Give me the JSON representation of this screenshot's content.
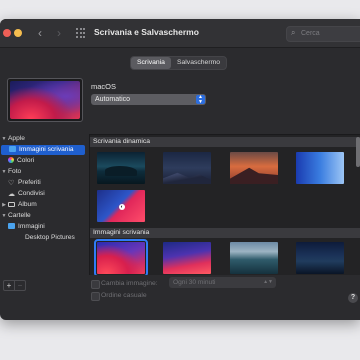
{
  "window": {
    "title": "Scrivania e Salvaschermo"
  },
  "search": {
    "placeholder": "Cerca"
  },
  "tabs": [
    {
      "label": "Scrivania",
      "active": true
    },
    {
      "label": "Salvaschermo",
      "active": false
    }
  ],
  "current": {
    "name": "macOS",
    "mode": "Automatico"
  },
  "sidebar": {
    "groups": [
      {
        "label": "Apple",
        "items": [
          {
            "label": "Immagini scrivania",
            "selected": true
          },
          {
            "label": "Colori"
          }
        ]
      },
      {
        "label": "Foto",
        "items": [
          {
            "label": "Preferiti"
          },
          {
            "label": "Condivisi"
          },
          {
            "label": "Album"
          }
        ]
      },
      {
        "label": "Cartelle",
        "items": [
          {
            "label": "Immagini"
          },
          {
            "label": "Desktop Pictures"
          }
        ]
      }
    ]
  },
  "sections": [
    {
      "label": "Scrivania dinamica"
    },
    {
      "label": "Immagini scrivania"
    }
  ],
  "options": {
    "change_label": "Cambia immagine:",
    "interval": "Ogni 30 minuti",
    "random_label": "Ordine casuale"
  },
  "buttons": {
    "add": "+",
    "remove": "−",
    "help": "?"
  },
  "colors": {
    "accent": "#2f7cf6",
    "selection": "#1f5fce"
  }
}
